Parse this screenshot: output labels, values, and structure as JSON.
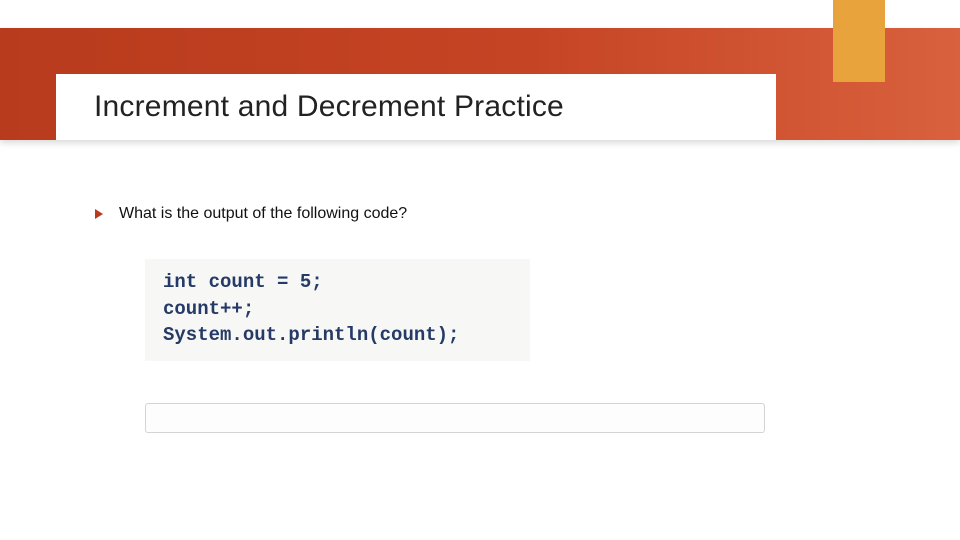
{
  "title": "Increment and Decrement Practice",
  "bullet": {
    "text": "What is the output of the following code?"
  },
  "code": {
    "line1": "int count = 5;",
    "line2": "count++;",
    "line3": "System.out.println(count);"
  },
  "answer": {
    "value": ""
  }
}
